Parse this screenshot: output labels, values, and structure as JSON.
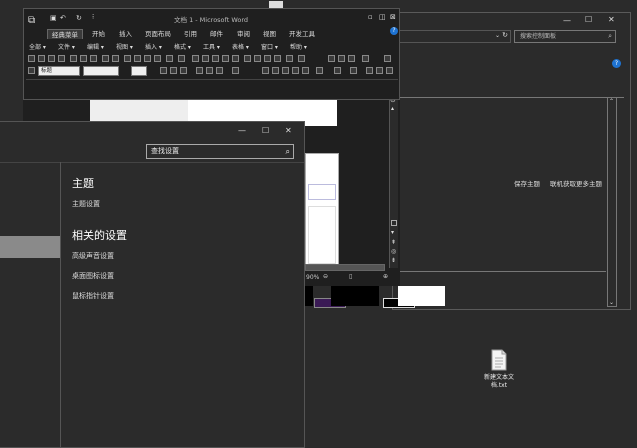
{
  "word": {
    "title": "文档 1 - Microsoft Word",
    "tabs": [
      "经典菜单",
      "开始",
      "插入",
      "页面布局",
      "引用",
      "邮件",
      "审阅",
      "视图",
      "开发工具"
    ],
    "menus": [
      "全部 ▾",
      "文件 ▾",
      "编辑 ▾",
      "视图 ▾",
      "插入 ▾",
      "格式 ▾",
      "工具 ▾",
      "表格 ▾",
      "窗口 ▾",
      "帮助 ▾"
    ],
    "style_combo": "标题",
    "zoom": "90%"
  },
  "control_panel": {
    "search_placeholder": "搜索控制面板",
    "links": [
      "保存主题",
      "联机获取更多主题"
    ],
    "help_icon": "?"
  },
  "settings": {
    "search_placeholder": "查找设置",
    "section_theme": "主题",
    "theme_link": "主题设置",
    "section_related": "相关的设置",
    "related": [
      "高级声音设置",
      "桌面图标设置",
      "鼠标指针设置"
    ],
    "controls": {
      "minimize": "—",
      "maximize": "☐",
      "close": "✕"
    }
  },
  "desktop": {
    "file_label": "新建文本文档.txt"
  },
  "colors": {
    "background": "#2b2b2b",
    "accent": "#1e73d2",
    "highlight": "#8a8a8a"
  }
}
